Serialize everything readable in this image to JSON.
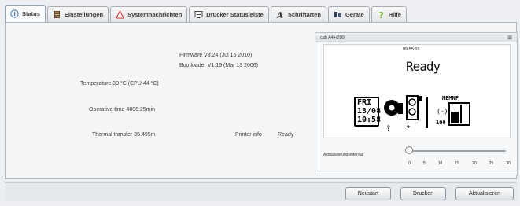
{
  "tabs": [
    {
      "label": "Status",
      "icon": "info-icon",
      "active": true
    },
    {
      "label": "Einstellungen",
      "icon": "settings-icon"
    },
    {
      "label": "Systemnachrichten",
      "icon": "warning-icon"
    },
    {
      "label": "Drucker Statusleiste",
      "icon": "monitor-icon"
    },
    {
      "label": "Schriftarten",
      "icon": "font-icon"
    },
    {
      "label": "Geräte",
      "icon": "devices-icon"
    },
    {
      "label": "Hilfe",
      "icon": "help-icon"
    }
  ],
  "status": {
    "firmware": "Firmware V3.24 (Jul 15 2010)",
    "bootloader": "Bootloader V1.19 (Mar 13 2006)",
    "temperature": "Temperature 30 °C (CPU 44 °C)",
    "operative_time": "Operative time 4806:25min",
    "thermal_transfer": "Thermal transfer 35.495m",
    "printer_info_label": "Printer info",
    "printer_info_value": "Ready"
  },
  "lcd_window": {
    "title": "cab A4+/200",
    "close": "⊠",
    "time": "09:55:59",
    "status": "Ready",
    "date": [
      "FRI",
      "13/08",
      "10:58"
    ],
    "memory_label": "MEMNP",
    "question_marks": [
      "?",
      "?"
    ],
    "indicator": "(-)",
    "level": "100",
    "slider_label": "Aktualisierungsintervall",
    "slider_value": 0,
    "slider_ticks": [
      "0",
      "5",
      "10",
      "15",
      "20",
      "25",
      "30"
    ]
  },
  "buttons": {
    "restart": "Neustart",
    "print": "Drucken",
    "refresh": "Aktualisieren"
  }
}
